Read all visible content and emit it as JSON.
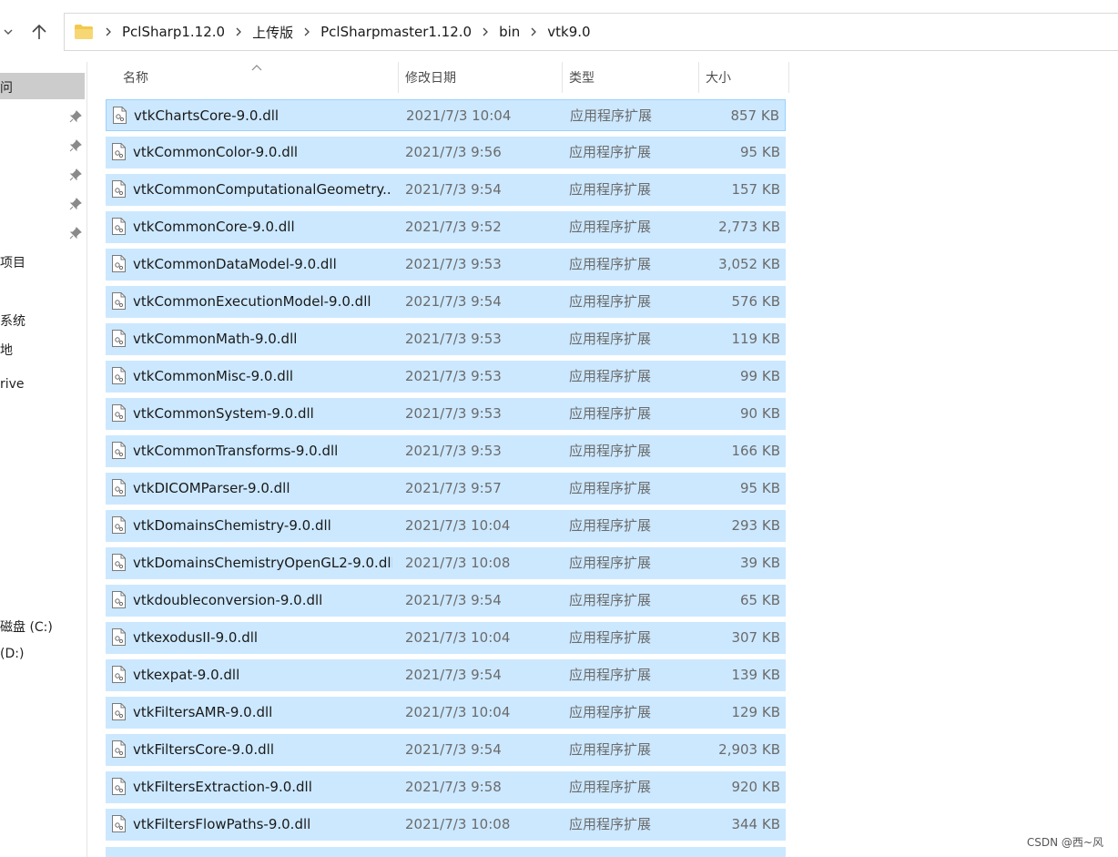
{
  "address": {
    "crumbs": [
      "PclSharp1.12.0",
      "上传版",
      "PclSharpmaster1.12.0",
      "bin",
      "vtk9.0"
    ]
  },
  "sidebar": {
    "items": [
      "问",
      "项目",
      "系统",
      "地",
      "rive",
      "磁盘 (C:)",
      "(D:)"
    ]
  },
  "columns": {
    "name": "名称",
    "date": "修改日期",
    "type": "类型",
    "size": "大小"
  },
  "files": [
    {
      "name": "vtkChartsCore-9.0.dll",
      "date": "2021/7/3 10:04",
      "type": "应用程序扩展",
      "size": "857 KB"
    },
    {
      "name": "vtkCommonColor-9.0.dll",
      "date": "2021/7/3 9:56",
      "type": "应用程序扩展",
      "size": "95 KB"
    },
    {
      "name": "vtkCommonComputationalGeometry...",
      "date": "2021/7/3 9:54",
      "type": "应用程序扩展",
      "size": "157 KB"
    },
    {
      "name": "vtkCommonCore-9.0.dll",
      "date": "2021/7/3 9:52",
      "type": "应用程序扩展",
      "size": "2,773 KB"
    },
    {
      "name": "vtkCommonDataModel-9.0.dll",
      "date": "2021/7/3 9:53",
      "type": "应用程序扩展",
      "size": "3,052 KB"
    },
    {
      "name": "vtkCommonExecutionModel-9.0.dll",
      "date": "2021/7/3 9:54",
      "type": "应用程序扩展",
      "size": "576 KB"
    },
    {
      "name": "vtkCommonMath-9.0.dll",
      "date": "2021/7/3 9:53",
      "type": "应用程序扩展",
      "size": "119 KB"
    },
    {
      "name": "vtkCommonMisc-9.0.dll",
      "date": "2021/7/3 9:53",
      "type": "应用程序扩展",
      "size": "99 KB"
    },
    {
      "name": "vtkCommonSystem-9.0.dll",
      "date": "2021/7/3 9:53",
      "type": "应用程序扩展",
      "size": "90 KB"
    },
    {
      "name": "vtkCommonTransforms-9.0.dll",
      "date": "2021/7/3 9:53",
      "type": "应用程序扩展",
      "size": "166 KB"
    },
    {
      "name": "vtkDICOMParser-9.0.dll",
      "date": "2021/7/3 9:57",
      "type": "应用程序扩展",
      "size": "95 KB"
    },
    {
      "name": "vtkDomainsChemistry-9.0.dll",
      "date": "2021/7/3 10:04",
      "type": "应用程序扩展",
      "size": "293 KB"
    },
    {
      "name": "vtkDomainsChemistryOpenGL2-9.0.dll",
      "date": "2021/7/3 10:08",
      "type": "应用程序扩展",
      "size": "39 KB"
    },
    {
      "name": "vtkdoubleconversion-9.0.dll",
      "date": "2021/7/3 9:54",
      "type": "应用程序扩展",
      "size": "65 KB"
    },
    {
      "name": "vtkexodusII-9.0.dll",
      "date": "2021/7/3 10:04",
      "type": "应用程序扩展",
      "size": "307 KB"
    },
    {
      "name": "vtkexpat-9.0.dll",
      "date": "2021/7/3 9:54",
      "type": "应用程序扩展",
      "size": "139 KB"
    },
    {
      "name": "vtkFiltersAMR-9.0.dll",
      "date": "2021/7/3 10:04",
      "type": "应用程序扩展",
      "size": "129 KB"
    },
    {
      "name": "vtkFiltersCore-9.0.dll",
      "date": "2021/7/3 9:54",
      "type": "应用程序扩展",
      "size": "2,903 KB"
    },
    {
      "name": "vtkFiltersExtraction-9.0.dll",
      "date": "2021/7/3 9:58",
      "type": "应用程序扩展",
      "size": "920 KB"
    },
    {
      "name": "vtkFiltersFlowPaths-9.0.dll",
      "date": "2021/7/3 10:08",
      "type": "应用程序扩展",
      "size": "344 KB"
    }
  ],
  "watermark": "CSDN @西~风",
  "colors": {
    "selection": "#cce8ff",
    "selection_border": "#99d1ff",
    "sidebar_selected": "#cccccc",
    "folder": "#f2c94c"
  }
}
